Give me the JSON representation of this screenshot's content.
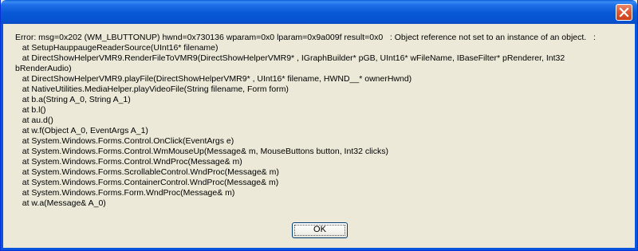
{
  "window": {
    "title": "",
    "close_icon": "close-x-icon"
  },
  "message": {
    "lines": [
      "Error: msg=0x202 (WM_LBUTTONUP) hwnd=0x730136 wparam=0x0 lparam=0x9a009f result=0x0   : Object reference not set to an instance of an object.   :",
      "   at SetupHauppaugeReaderSource(UInt16* filename)",
      "   at DirectShowHelperVMR9.RenderFileToVMR9(DirectShowHelperVMR9* , IGraphBuilder* pGB, UInt16* wFileName, IBaseFilter* pRenderer, Int32",
      "bRenderAudio)",
      "   at DirectShowHelperVMR9.playFile(DirectShowHelperVMR9* , UInt16* filename, HWND__* ownerHwnd)",
      "   at NativeUtilities.MediaHelper.playVideoFile(String filename, Form form)",
      "   at b.a(String A_0, String A_1)",
      "   at b.l()",
      "   at au.d()",
      "   at w.f(Object A_0, EventArgs A_1)",
      "   at System.Windows.Forms.Control.OnClick(EventArgs e)",
      "   at System.Windows.Forms.Control.WmMouseUp(Message& m, MouseButtons button, Int32 clicks)",
      "   at System.Windows.Forms.Control.WndProc(Message& m)",
      "   at System.Windows.Forms.ScrollableControl.WndProc(Message& m)",
      "   at System.Windows.Forms.ContainerControl.WndProc(Message& m)",
      "   at System.Windows.Forms.Form.WndProc(Message& m)",
      "   at w.a(Message& A_0)"
    ]
  },
  "buttons": {
    "ok_label": "OK"
  },
  "colors": {
    "title_bar": "#0858d6",
    "dialog_bg": "#ece9d8",
    "close_button": "#de5b36"
  }
}
